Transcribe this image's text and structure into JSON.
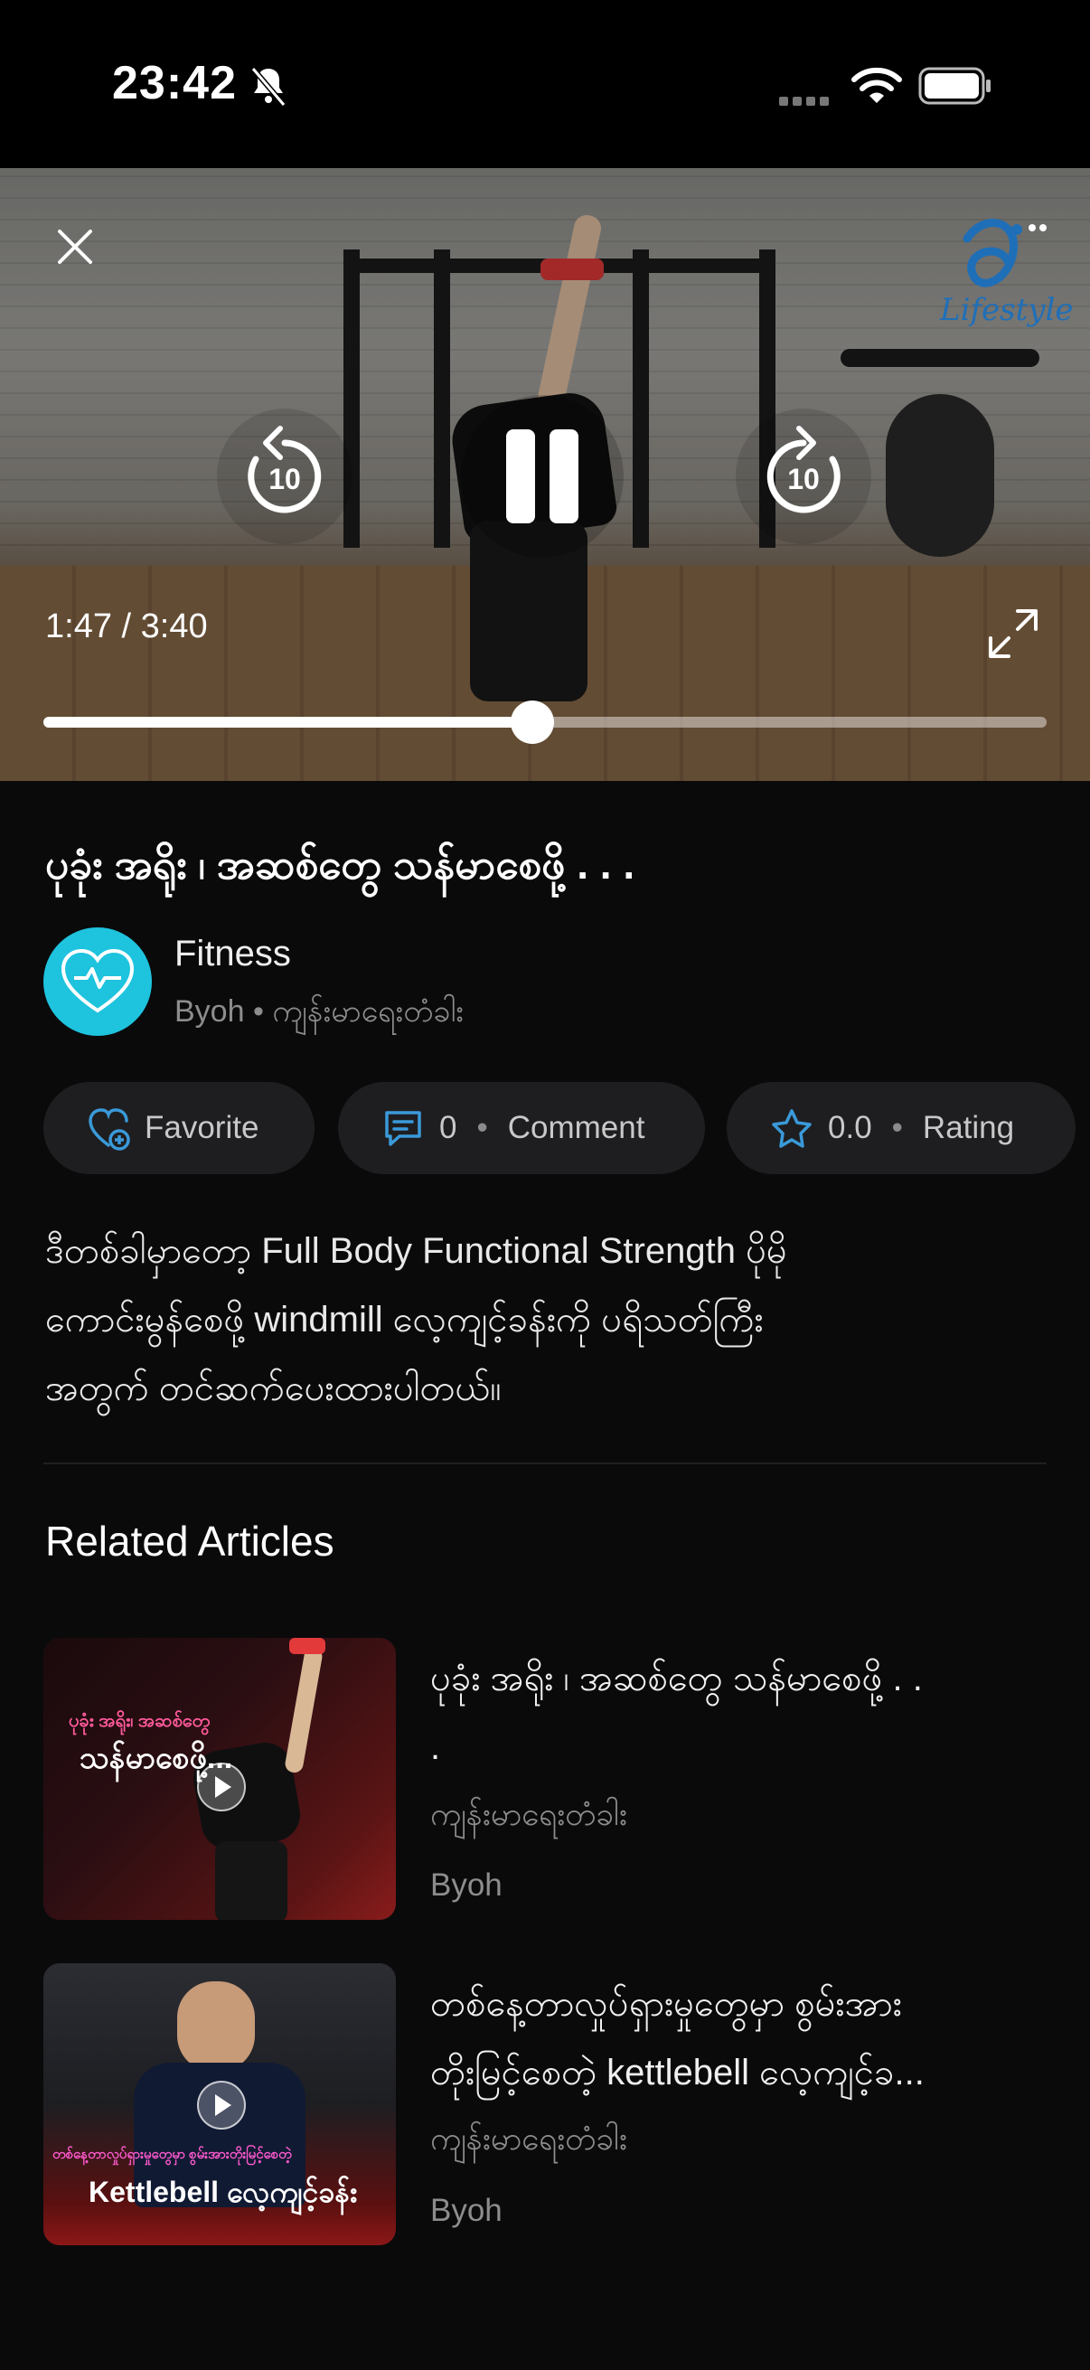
{
  "status_bar": {
    "time": "23:42"
  },
  "player": {
    "timecode": "1:47 / 3:40",
    "progress_fraction": 0.487,
    "rewind_label": "10",
    "forward_label": "10",
    "logo_text": "Lifestyle"
  },
  "video": {
    "title": "ပုခုံး အရိုး ၊ အဆစ်တွေ သန်မာစေဖို့ . . .",
    "channel_name": "Fitness",
    "channel_meta": "Byoh • ကျန်းမာရေးတံခါး",
    "actions": {
      "favorite": "Favorite",
      "comment_count": "0",
      "comment_label": "Comment",
      "rating_value": "0.0",
      "rating_label": "Rating"
    },
    "description_lines": [
      "ဒီတစ်ခါမှာတော့ Full Body Functional Strength ပိုမို",
      "ကောင်းမွန်စေဖို့ windmill လေ့ကျင့်ခန်းကို ပရိသတ်ကြီး",
      "အတွက် တင်ဆက်ပေးထားပါတယ်။"
    ]
  },
  "related": {
    "heading": "Related Articles",
    "items": [
      {
        "title_lines": [
          "ပုခုံး အရိုး ၊ အဆစ်တွေ သန်မာစေဖို့ . .",
          "."
        ],
        "category": "ကျန်းမာရေးတံခါး",
        "author": "Byoh",
        "thumb_text_1": "ပုခုံး အရိုး၊ အဆစ်တွေ",
        "thumb_text_2": "သန်မာစေဖို့..."
      },
      {
        "title_lines": [
          "တစ်နေ့တာလှုပ်ရှားမှုတွေမှာ စွမ်းအား",
          "တိုးမြင့်စေတဲ့ kettlebell လေ့ကျင့်ခ..."
        ],
        "category": "ကျန်းမာရေးတံခါး",
        "author": "Byoh",
        "thumb_text_1": "တစ်နေ့တာလှုပ်ရှားမှုတွေမှာ စွမ်းအားတိုးမြင့်စေတဲ့",
        "thumb_text_2": "Kettlebell လေ့ကျင့်ခန်း"
      }
    ]
  },
  "colors": {
    "accent": "#1ec3de",
    "icon_blue": "#3a9ad9",
    "background": "#0a0a0b"
  }
}
